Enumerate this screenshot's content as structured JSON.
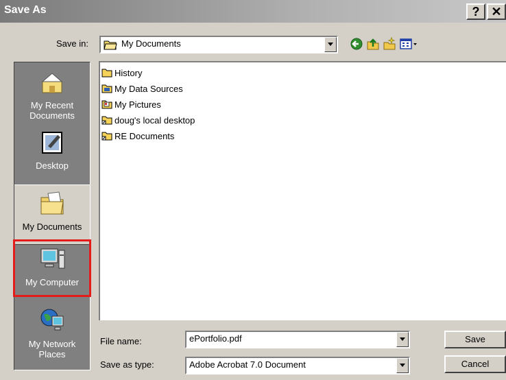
{
  "window": {
    "title": "Save As",
    "help_label": "?",
    "close_label": "✕"
  },
  "toolbar": {
    "save_in_label": "Save in:",
    "save_in_value": "My Documents",
    "icons": [
      "back-icon",
      "up-folder-icon",
      "new-folder-icon",
      "view-menu-icon"
    ]
  },
  "places": [
    {
      "label": "My Recent Documents",
      "icon": "recent-documents-icon"
    },
    {
      "label": "Desktop",
      "icon": "desktop-icon"
    },
    {
      "label": "My Documents",
      "icon": "my-documents-icon",
      "selected": true
    },
    {
      "label": "My Computer",
      "icon": "my-computer-icon",
      "highlighted": true
    },
    {
      "label": "My Network Places",
      "icon": "network-places-icon"
    }
  ],
  "files": [
    {
      "name": "History",
      "icon": "folder-icon"
    },
    {
      "name": "My Data Sources",
      "icon": "data-sources-folder-icon"
    },
    {
      "name": "My Pictures",
      "icon": "pictures-folder-icon"
    },
    {
      "name": "doug's local desktop",
      "icon": "folder-shortcut-icon"
    },
    {
      "name": "RE Documents",
      "icon": "folder-shortcut-icon"
    }
  ],
  "form": {
    "file_name_label": "File name:",
    "file_name_value": "ePortfolio.pdf",
    "save_type_label": "Save as type:",
    "save_type_value": "Adobe Acrobat 7.0 Document"
  },
  "buttons": {
    "save": "Save",
    "cancel": "Cancel"
  },
  "colors": {
    "highlight_border": "#e31b1b"
  }
}
